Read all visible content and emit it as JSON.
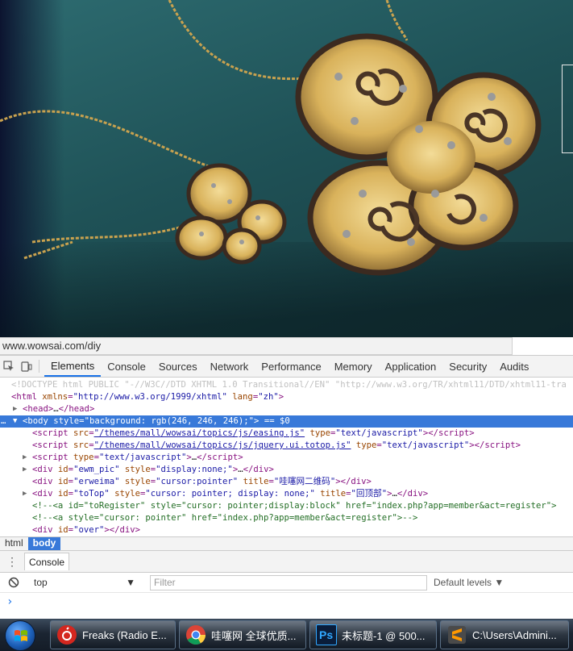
{
  "status_url": "www.wowsai.com/diy",
  "devtools": {
    "tabs": [
      "Elements",
      "Console",
      "Sources",
      "Network",
      "Performance",
      "Memory",
      "Application",
      "Security",
      "Audits"
    ],
    "active_tab": "Elements",
    "lines": {
      "doctype": "<!DOCTYPE html PUBLIC \"-//W3C//DTD XHTML 1.0 Transitional//EN\" \"http://www.w3.org/TR/xhtml11/DTD/xhtml11-tra",
      "html_open": "<html",
      "html_attr_name": "xmlns",
      "html_attr_val": "\"http://www.w3.org/1999/xhtml\"",
      "html_attr2_name": "lang",
      "html_attr2_val": "\"zh\"",
      "head": "<head>",
      "head_ellipsis": "…",
      "head_close": "</head>",
      "body_open": "<body",
      "body_attr": "style",
      "body_val": "\"background: rgb(246, 246, 246);\"",
      "body_end": ">",
      "body_marker": "== $0",
      "script1_src": "\"/themes/mall/wowsai/topics/js/easing.js\"",
      "script2_src": "\"/themes/mall/wowsai/topics/js/jquery.ui.totop.js\"",
      "script_type": "\"text/javascript\"",
      "div1_id": "\"ewm_pic\"",
      "div1_style": "\"display:none;\"",
      "div2_id": "\"erweima\"",
      "div2_style": "\"cursor:pointer\"",
      "div2_title": "\"哇噻网二维码\"",
      "div3_id": "\"toTop\"",
      "div3_style": "\"cursor: pointer; display: none;\"",
      "div3_title": "\"回顶部\"",
      "comment1": "<!--<a id=\"toRegister\" style=\"cursor: pointer;display:block\" href=\"index.php?app=member&act=register\">",
      "comment2": "<!--<a  style=\"cursor: pointer\" href=\"index.php?app=member&act=register\">-->",
      "div4_id": "\"over\""
    },
    "breadcrumbs": [
      "html",
      "body"
    ],
    "drawer_tab": "Console",
    "console": {
      "context": "top",
      "filter_placeholder": "Filter",
      "levels": "Default levels ▼",
      "prompt": "›"
    }
  },
  "taskbar": {
    "buttons": [
      {
        "label": "Freaks (Radio E...",
        "icon": "netease-music-icon",
        "color": "#d4271f"
      },
      {
        "label": "哇噻网 全球优质...",
        "icon": "chrome-icon",
        "color": "#4285f4"
      },
      {
        "label": "未标题-1 @ 500...",
        "icon": "photoshop-icon",
        "color": "#0a1d3a"
      },
      {
        "label": "C:\\Users\\Admini...",
        "icon": "sublime-icon",
        "color": "#ff9800"
      }
    ],
    "ps_text": "Ps"
  }
}
